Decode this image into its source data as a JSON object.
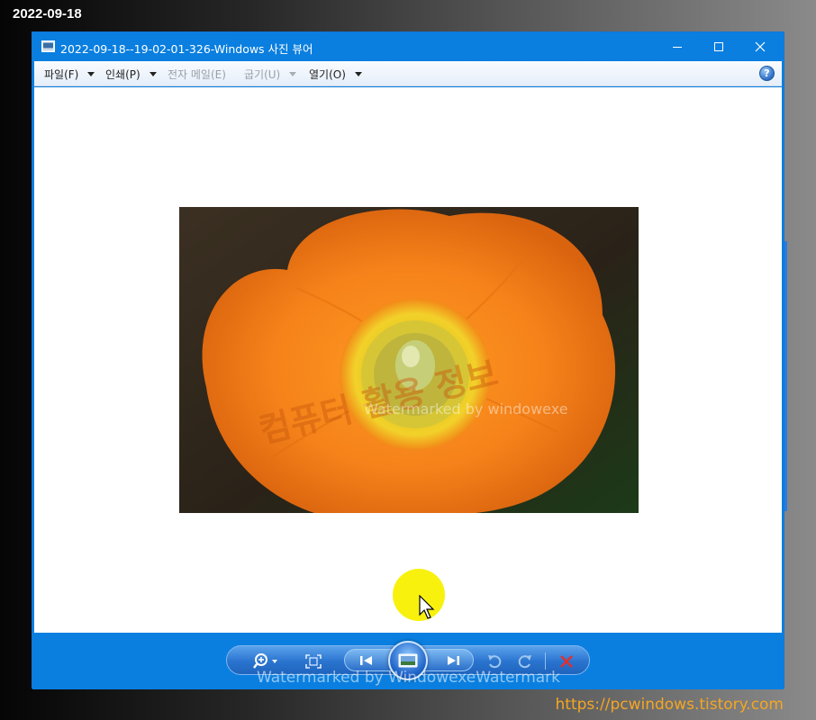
{
  "overlay": {
    "date": "2022-09-18",
    "source_url": "https://pcwindows.tistory.com"
  },
  "window": {
    "title": "2022-09-18--19-02-01-326-Windows 사진 뷰어",
    "accent": "#0a7fe0",
    "controls": {
      "minimize": "minimize-icon",
      "maximize": "maximize-icon",
      "close": "close-icon"
    }
  },
  "menu": {
    "items": [
      {
        "label": "파일(F)",
        "enabled": true
      },
      {
        "label": "인쇄(P)",
        "enabled": true
      },
      {
        "label": "전자 메일(E)",
        "enabled": false
      },
      {
        "label": "굽기(U)",
        "enabled": false
      },
      {
        "label": "열기(O)",
        "enabled": true
      }
    ],
    "help_icon": "help-icon"
  },
  "viewer": {
    "photo_subject": "orange poppy flower",
    "photo_watermark_text": "컴퓨터 활용 정보",
    "photo_watermark_sub": "Watermarked by windowexe"
  },
  "controls": {
    "icons": [
      "zoom-icon",
      "actual-size-icon",
      "previous-icon",
      "slideshow-icon",
      "next-icon",
      "rotate-left-icon",
      "rotate-right-icon",
      "delete-icon"
    ],
    "watermark": "Watermarked by WindowexeWatermark"
  }
}
